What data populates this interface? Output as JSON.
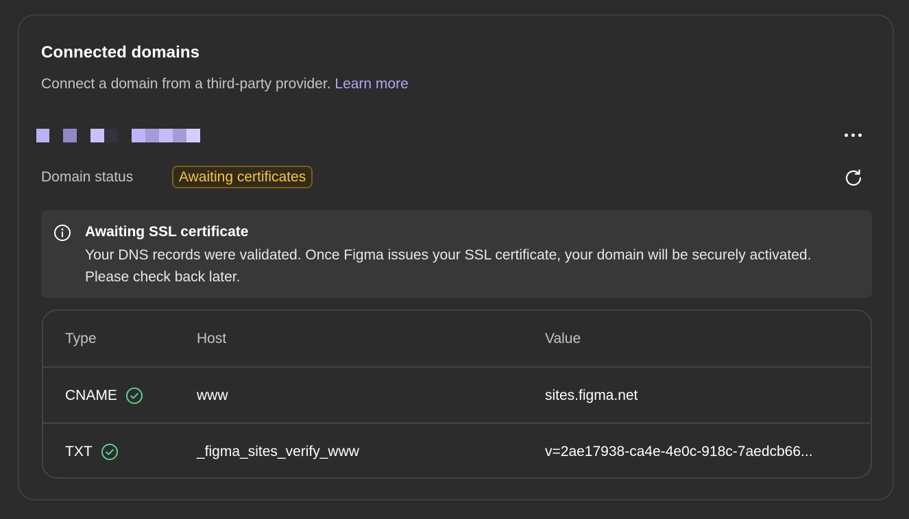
{
  "section": {
    "title": "Connected domains",
    "subtitle": "Connect a domain from a third-party provider.",
    "learn_more": "Learn more"
  },
  "domain": {
    "name_redacted": true,
    "status_label": "Domain status",
    "status_badge": "Awaiting certificates",
    "badge_color": "#f3c347"
  },
  "notice": {
    "icon": "info-icon",
    "title": "Awaiting SSL certificate",
    "body": "Your DNS records were validated. Once Figma issues your SSL certificate, your domain will be securely activated. Please check back later."
  },
  "dns_table": {
    "columns": [
      "Type",
      "Host",
      "Value"
    ],
    "rows": [
      {
        "type": "CNAME",
        "status_icon": "check-circle-icon",
        "host": "www",
        "value": "sites.figma.net"
      },
      {
        "type": "TXT",
        "status_icon": "check-circle-icon",
        "host": "_figma_sites_verify_www",
        "value": "v=2ae17938-ca4e-4e0c-918c-7aedcb66..."
      }
    ]
  },
  "colors": {
    "accent_link": "#b3a7f5",
    "success": "#5fcf8f",
    "warning": "#f3c347",
    "background": "#2c2c2c"
  }
}
